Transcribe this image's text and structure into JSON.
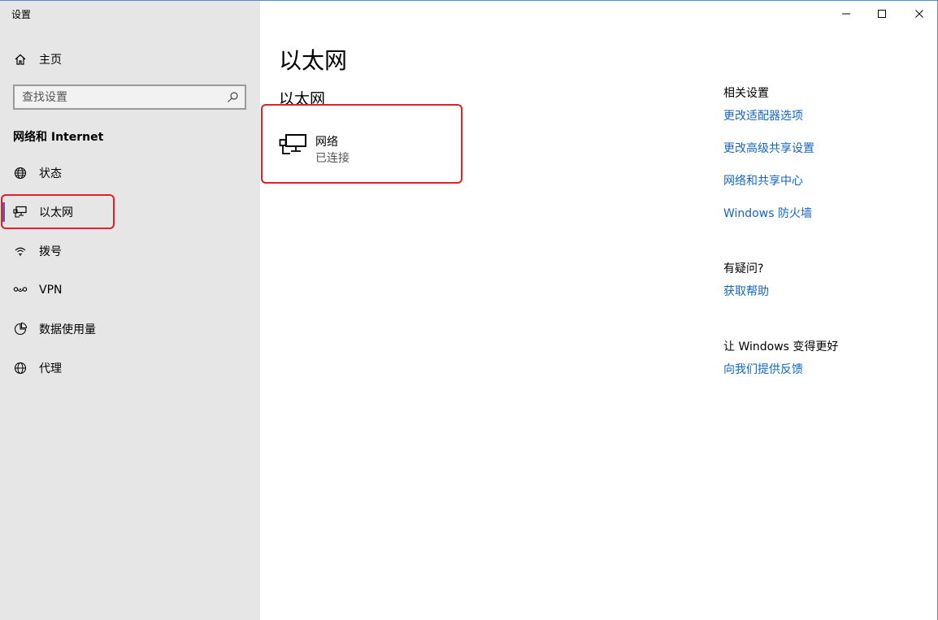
{
  "window": {
    "title": "设置"
  },
  "sidebar": {
    "home_label": "主页",
    "search_placeholder": "查找设置",
    "section_heading": "网络和 Internet",
    "items": [
      {
        "label": "状态",
        "icon": "status-globe-icon"
      },
      {
        "label": "以太网",
        "icon": "ethernet-icon",
        "selected": true
      },
      {
        "label": "拨号",
        "icon": "dialup-icon"
      },
      {
        "label": "VPN",
        "icon": "vpn-icon"
      },
      {
        "label": "数据使用量",
        "icon": "data-usage-icon"
      },
      {
        "label": "代理",
        "icon": "proxy-globe-icon"
      }
    ]
  },
  "main": {
    "page_title": "以太网",
    "sub_title": "以太网",
    "network": {
      "name": "网络",
      "status": "已连接"
    }
  },
  "related": {
    "heading": "相关设置",
    "links": [
      "更改适配器选项",
      "更改高级共享设置",
      "网络和共享中心",
      "Windows 防火墙"
    ]
  },
  "help": {
    "heading": "有疑问?",
    "link": "获取帮助"
  },
  "feedback": {
    "heading": "让 Windows 变得更好",
    "link": "向我们提供反馈"
  },
  "colors": {
    "sidebar_bg": "#e6e6e6",
    "link": "#1565c0",
    "selection_bar": "#5a5aa8",
    "annotation": "#e0202a"
  }
}
